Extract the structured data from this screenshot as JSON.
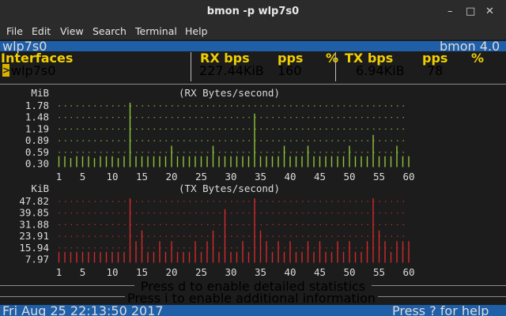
{
  "window": {
    "title": "bmon -p wlp7s0",
    "minimize": "–",
    "maximize": "□",
    "close": "✕"
  },
  "menu": [
    "File",
    "Edit",
    "View",
    "Search",
    "Terminal",
    "Help"
  ],
  "header": {
    "left": "wlp7s0",
    "right": "bmon 4.0"
  },
  "table": {
    "interfaces_label": "Interfaces",
    "rx_bps_label": "RX bps",
    "rx_pps_label": "pps",
    "rx_pct_label": "%",
    "tx_bps_label": "TX bps",
    "tx_pps_label": "pps",
    "tx_pct_label": "%",
    "row": {
      "cursor": ">",
      "name": "wlp7s0",
      "rx_bps": "227.44KiB",
      "rx_pps": "160",
      "tx_bps": "6.94KiB",
      "tx_pps": "78"
    }
  },
  "colors": {
    "rx": "#8fc63a",
    "tx": "#d02a2a",
    "accent_bar": "#1f5fa8",
    "highlight": "#f0d000"
  },
  "chart_data": [
    {
      "type": "bar",
      "title": "(RX Bytes/second)",
      "ylabel": "MiB",
      "yticks": [
        "1.78",
        "1.48",
        "1.19",
        "0.89",
        "0.59",
        "0.30"
      ],
      "xticks": [
        "1",
        "5",
        "10",
        "15",
        "20",
        "25",
        "30",
        "35",
        "40",
        "45",
        "50",
        "55",
        "60"
      ],
      "ylim": [
        0,
        1.78
      ],
      "x": [
        1,
        2,
        3,
        4,
        5,
        6,
        7,
        8,
        9,
        10,
        11,
        12,
        13,
        14,
        15,
        16,
        17,
        18,
        19,
        20,
        21,
        22,
        23,
        24,
        25,
        26,
        27,
        28,
        29,
        30,
        31,
        32,
        33,
        34,
        35,
        36,
        37,
        38,
        39,
        40,
        41,
        42,
        43,
        44,
        45,
        46,
        47,
        48,
        49,
        50,
        51,
        52,
        53,
        54,
        55,
        56,
        57,
        58,
        59,
        60
      ],
      "values": [
        0.3,
        0.3,
        0.25,
        0.3,
        0.3,
        0.3,
        0.25,
        0.3,
        0.3,
        0.3,
        0.25,
        0.3,
        1.78,
        0.3,
        0.3,
        0.3,
        0.3,
        0.3,
        0.3,
        0.59,
        0.3,
        0.3,
        0.3,
        0.3,
        0.3,
        0.3,
        0.59,
        0.3,
        0.3,
        0.3,
        0.3,
        0.3,
        0.3,
        1.48,
        0.3,
        0.3,
        0.3,
        0.3,
        0.59,
        0.3,
        0.3,
        0.3,
        0.59,
        0.3,
        0.3,
        0.3,
        0.3,
        0.3,
        0.3,
        0.59,
        0.3,
        0.3,
        0.3,
        0.89,
        0.3,
        0.3,
        0.3,
        0.59,
        0.3,
        0.3
      ]
    },
    {
      "type": "bar",
      "title": "(TX Bytes/second)",
      "ylabel": "KiB",
      "yticks": [
        "47.82",
        "39.85",
        "31.88",
        "23.91",
        "15.94",
        "7.97"
      ],
      "xticks": [
        "1",
        "5",
        "10",
        "15",
        "20",
        "25",
        "30",
        "35",
        "40",
        "45",
        "50",
        "55",
        "60"
      ],
      "ylim": [
        0,
        47.82
      ],
      "x": [
        1,
        2,
        3,
        4,
        5,
        6,
        7,
        8,
        9,
        10,
        11,
        12,
        13,
        14,
        15,
        16,
        17,
        18,
        19,
        20,
        21,
        22,
        23,
        24,
        25,
        26,
        27,
        28,
        29,
        30,
        31,
        32,
        33,
        34,
        35,
        36,
        37,
        38,
        39,
        40,
        41,
        42,
        43,
        44,
        45,
        46,
        47,
        48,
        49,
        50,
        51,
        52,
        53,
        54,
        55,
        56,
        57,
        58,
        59,
        60
      ],
      "values": [
        7.97,
        7.97,
        7.97,
        7.97,
        7.97,
        7.97,
        7.97,
        7.97,
        7.97,
        7.97,
        7.97,
        7.97,
        47.82,
        15.94,
        23.91,
        7.97,
        7.97,
        15.94,
        7.97,
        15.94,
        7.97,
        7.97,
        7.97,
        15.94,
        7.97,
        15.94,
        23.91,
        7.97,
        39.85,
        7.97,
        7.97,
        15.94,
        7.97,
        47.82,
        23.91,
        15.94,
        7.97,
        15.94,
        7.97,
        15.94,
        7.97,
        7.97,
        15.94,
        7.97,
        15.94,
        7.97,
        7.97,
        15.94,
        7.97,
        15.94,
        7.97,
        7.97,
        15.94,
        47.82,
        23.91,
        15.94,
        7.97,
        15.94,
        15.94,
        15.94
      ]
    }
  ],
  "footer": {
    "hint1": "Press d to enable detailed statistics",
    "hint2": "Press i to enable additional information",
    "datetime": "Fri Aug 25 22:13:50 2017",
    "help": "Press ? for help"
  }
}
